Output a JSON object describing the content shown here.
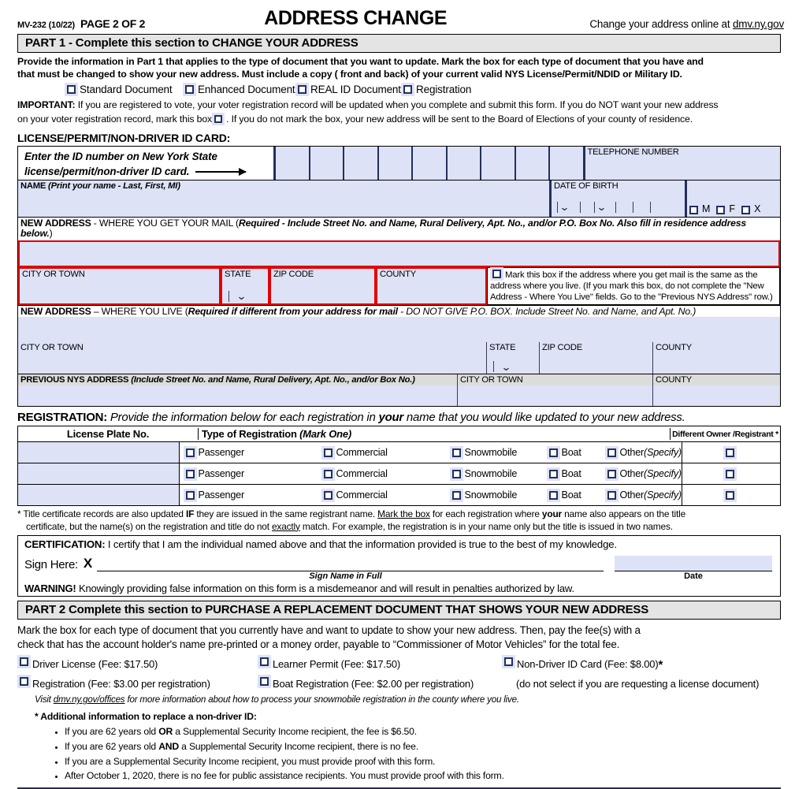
{
  "header": {
    "form_no": "MV-232 (10/22)",
    "page_of": "PAGE 2 OF 2",
    "title": "ADDRESS CHANGE",
    "online_note_pre": "Change your address online at ",
    "online_link": "dmv.ny.gov"
  },
  "part1": {
    "band": "PART 1 - Complete this section to CHANGE YOUR ADDRESS",
    "intro_line1": "Provide the information in Part 1 that applies to the type of document that you want to update.  Mark the box for each type of document that you have and",
    "intro_line2_a": "that must be changed to show your new address. Must include a copy ( front and back) of your current valid NYS License/Permit/NDID or Military ID.",
    "doc_types": [
      {
        "label": "Standard Document"
      },
      {
        "label": "Enhanced Document"
      },
      {
        "label": "REAL ID Document"
      },
      {
        "label": "Registration"
      }
    ],
    "important_label": "IMPORTANT:",
    "important_a": " If you are registered to vote, your voter registration record will be updated when you complete and submit this form.  If you do NOT want your new address",
    "important_b": "on your voter registration record, mark this box",
    "important_c": ". If you do not mark the box, your new address will be sent to the Board of Elections of your county of residence.",
    "license_section_label": "LICENSE/PERMIT/NON-DRIVER ID CARD:",
    "id_instruction_l1": "Enter the ID number on New York State",
    "id_instruction_l2": "license/permit/non-driver ID card.",
    "id_cell_count": 9,
    "telephone_label": "TELEPHONE NUMBER",
    "name_label_bold": "NAME",
    "name_label_italic": " (Print your name - Last, First, MI)",
    "dob_label": "DATE OF BIRTH",
    "sex_options": [
      "M",
      "F",
      "X"
    ],
    "mail_addr_bold": "NEW ADDRESS",
    "mail_addr_rest": " - WHERE YOU GET YOUR MAIL (",
    "mail_addr_req": "Required - Include Street No. and Name, Rural Delivery, Apt. No., and/or P.O. Box No. Also fill in residence address below.",
    "mail_addr_close": ")",
    "city_label": "CITY OR TOWN",
    "state_label": "STATE",
    "zip_label": "ZIP CODE",
    "county_label": "COUNTY",
    "same_box_text": "Mark this box if the address where you get mail is the same as the address where you live. (If you mark this box, do not complete the \"New Address - Where You Live\" fields. Go to the \"Previous NYS Address\" row.)",
    "live_addr_bold": "NEW ADDRESS",
    "live_addr_rest": " – WHERE YOU LIVE (",
    "live_addr_req": "Required if different from your address for mail",
    "live_addr_tail": " - DO NOT GIVE P.O. BOX. Include Street No. and Name, and  Apt. No.)",
    "prev_addr_bold": "PREVIOUS NYS ADDRESS",
    "prev_addr_italic": " (Include Street No. and Name, Rural Delivery, Apt. No., and/or Box No.)"
  },
  "registration": {
    "heading_bold": "REGISTRATION:",
    "heading_rest_a": " Provide the information below for each registration in ",
    "heading_your": "your",
    "heading_rest_b": " name that you would like updated to your new address.",
    "col_plate": "License Plate No.",
    "col_type_bold": "Type of Registration ",
    "col_type_italic": "(Mark One)",
    "col_owner": "Different Owner /Registrant *",
    "options": [
      "Passenger",
      "Commercial",
      "Snowmobile",
      "Boat"
    ],
    "other_label": "Other ",
    "other_italic": "(Specify)",
    "row_count": 3
  },
  "footnote": {
    "line1_a": "* Title certificate records are also updated ",
    "line1_if": "IF",
    "line1_b": " they are issued in the same registrant name.  ",
    "line1_mark": "Mark the box",
    "line1_c": " for each registration where ",
    "line1_your": "your",
    "line1_d": " name also appears on the title",
    "line2_a": "certificate, but the name(s) on the registration and title do not ",
    "line2_exactly": "exactly",
    "line2_b": " match.  For example, the registration is in your name only but the title is issued in two names."
  },
  "certification": {
    "label": "CERTIFICATION:",
    "text": " I certify that I am the individual named above and that the information provided is true to the best of my knowledge.",
    "sign_here": "Sign Here:",
    "x_mark": "X",
    "sign_caption": "Sign Name in Full",
    "date_caption": "Date",
    "warning_label": "WARNING!",
    "warning_text": "  Knowingly providing false information on this form is a misdemeanor and will result in penalties authorized by law."
  },
  "part2": {
    "band": "PART 2  Complete this section to PURCHASE A REPLACEMENT DOCUMENT THAT SHOWS YOUR NEW ADDRESS",
    "intro_line1": "Mark the box for each type of document that you currently have and want to update to show your new address. Then, pay the fee(s) with a",
    "intro_line2": "check that has the account holder's name pre-printed or a money order, payable to “Commissioner of Motor Vehicles” for the total fee.",
    "fees": [
      {
        "label": "Driver License (Fee:  $17.50)"
      },
      {
        "label": "Learner Permit (Fee:  $17.50)"
      },
      {
        "label": "Non-Driver ID Card (Fee:  $8.00)",
        "superscript": "*"
      },
      {
        "label": "Registration (Fee: $3.00 per registration)"
      },
      {
        "label": "Boat Registration (Fee: $2.00 per registration)"
      }
    ],
    "non_driver_note": "(do not select if you are requesting a license document)",
    "visit_pre": "Visit ",
    "visit_link": "dmv.ny.gov/offices",
    "visit_post": " for more information about how to process your snowmobile registration in the county where you live.",
    "additional_label": "*  Additional information to replace a non-driver ID:",
    "bullets": [
      {
        "pre": "If you are 62 years old ",
        "bold": "OR",
        "post": " a Supplemental Security Income recipient, the fee is $6.50."
      },
      {
        "pre": "If you are 62 years old ",
        "bold": "AND",
        "post": " a Supplemental Security Income recipient, there is no fee."
      },
      {
        "pre": "If you are a Supplemental Security Income recipient, you must provide proof with this form.",
        "bold": "",
        "post": ""
      },
      {
        "pre": "After October 1, 2020, there is no fee for public assistance recipients. You must provide proof with this form.",
        "bold": "",
        "post": ""
      }
    ]
  },
  "colors": {
    "field_fill": "#dde2f6",
    "band": "#e4e4e4",
    "required_outline": "#e20000",
    "checkbox_border": "#23305c"
  }
}
